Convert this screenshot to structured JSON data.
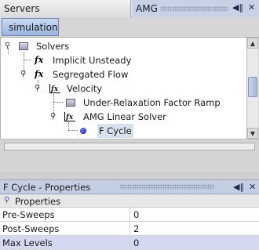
{
  "tabs": {
    "servers": "Servers",
    "amg": "AMG"
  },
  "toolbar": {
    "simulation_label": "simulation"
  },
  "tree": {
    "items": [
      {
        "label": "Solvers",
        "icon": "folder-icon"
      },
      {
        "label": "Implicit Unsteady",
        "icon": "function-icon"
      },
      {
        "label": "Segregated Flow",
        "icon": "function-icon"
      },
      {
        "label": "Velocity",
        "icon": "velocity-icon"
      },
      {
        "label": "Under-Relaxation Factor Ramp",
        "icon": "folder-icon"
      },
      {
        "label": "AMG Linear Solver",
        "icon": "velocity-icon"
      },
      {
        "label": "F Cycle",
        "icon": "blue-dot-icon",
        "selected": true
      }
    ]
  },
  "properties": {
    "title": "F Cycle - Properties",
    "group": "Properties",
    "rows": [
      {
        "name": "Pre-Sweeps",
        "value": "0"
      },
      {
        "name": "Post-Sweeps",
        "value": "2"
      },
      {
        "name": "Max Levels",
        "value": "0",
        "highlighted": true
      }
    ]
  },
  "colors": {
    "tab_active": "#c8d2e6",
    "selection": "#d8e0ee",
    "highlight_row": "#d4d8f0"
  }
}
